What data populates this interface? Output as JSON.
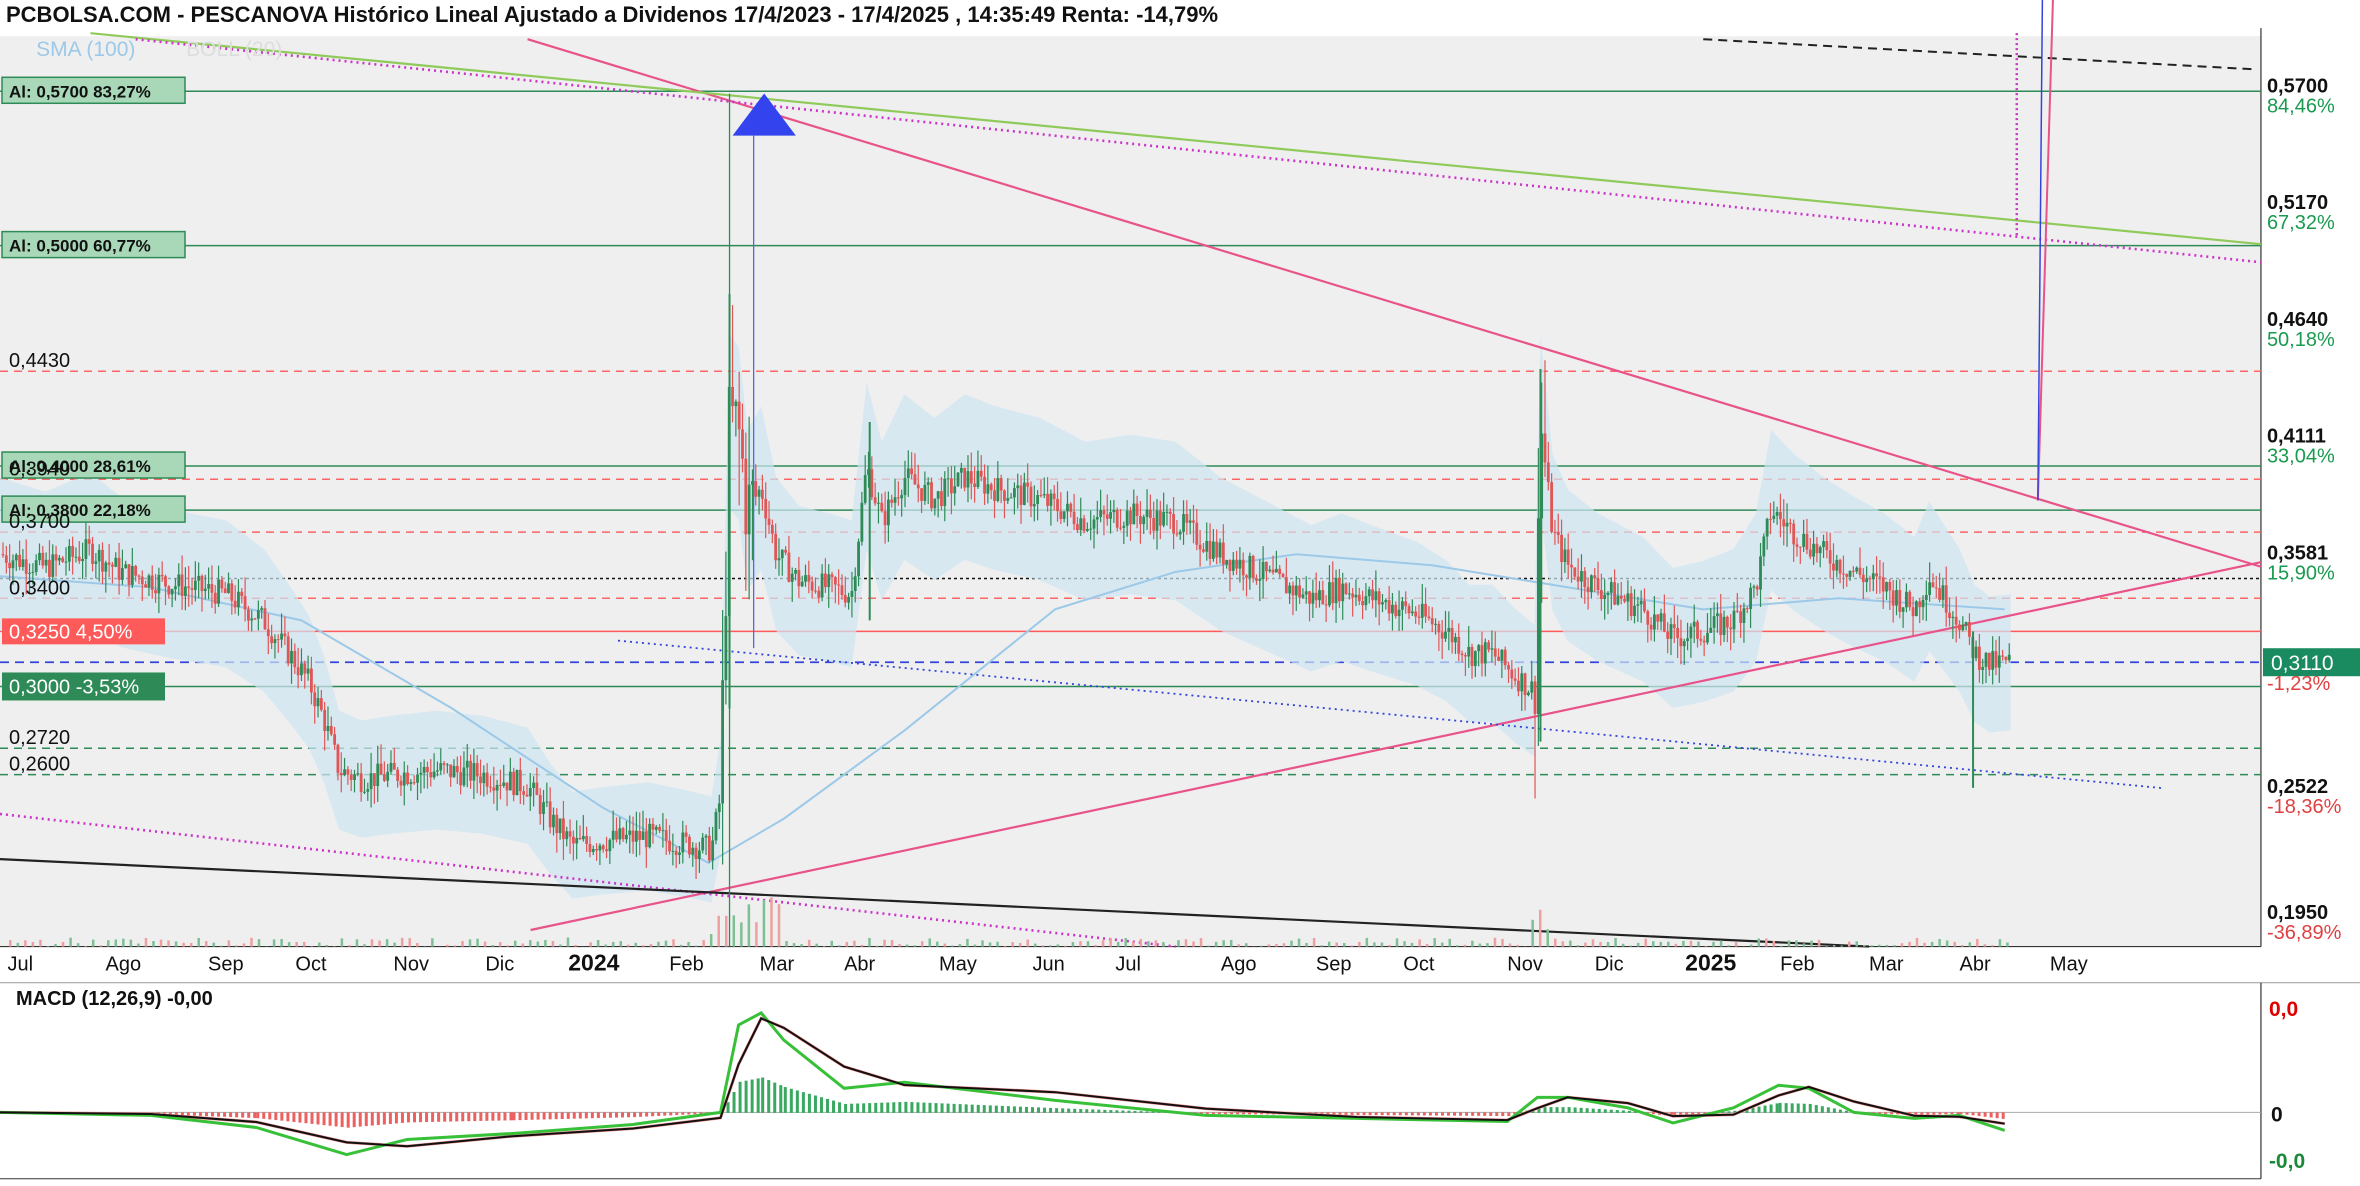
{
  "title": "PCBOLSA.COM - PESCANOVA Histórico Lineal Ajustado a Dividenos 17/4/2023 - 17/4/2025 , 14:35:49 Renta: -14,79%",
  "colors": {
    "up": "#2e8b57",
    "down": "#e05555",
    "pink": "#e8538a",
    "magenta": "#cc33cc",
    "blue": "#3344dd",
    "green": "#2e8b57",
    "lightgreen": "#8fca5a",
    "red": "#ff5a5a"
  },
  "chart_data": [
    {
      "type": "line",
      "name": "main",
      "legend": [
        "SMA (100)",
        "BOLL (20)"
      ],
      "ylim": [
        0.182,
        0.595
      ],
      "price_axis": [
        {
          "v": 0.57,
          "label": "0,5700",
          "pct": "84,46%",
          "pcolor": "#1a9a50"
        },
        {
          "v": 0.517,
          "label": "0,5170",
          "pct": "67,32%",
          "pcolor": "#1a9a50"
        },
        {
          "v": 0.464,
          "label": "0,4640",
          "pct": "50,18%",
          "pcolor": "#1a9a50"
        },
        {
          "v": 0.4111,
          "label": "0,4111",
          "pct": "33,04%",
          "pcolor": "#1a9a50"
        },
        {
          "v": 0.3581,
          "label": "0,3581",
          "pct": "15,90%",
          "pcolor": "#1a9a50"
        },
        {
          "v": 0.2522,
          "label": "0,2522",
          "pct": "-18,36%",
          "pcolor": "#e04040"
        },
        {
          "v": 0.195,
          "label": "0,1950",
          "pct": "-36,89%",
          "pcolor": "#e04040"
        }
      ],
      "current": {
        "v": 0.311,
        "label": "0,3110",
        "pct": "-1,23%"
      },
      "months": [
        {
          "label": "Jul",
          "x": 5,
          "bold": false
        },
        {
          "label": "Ago",
          "x": 70,
          "bold": false
        },
        {
          "label": "Sep",
          "x": 138,
          "bold": false
        },
        {
          "label": "Oct",
          "x": 196,
          "bold": false
        },
        {
          "label": "Nov",
          "x": 261,
          "bold": false
        },
        {
          "label": "Dic",
          "x": 322,
          "bold": false
        },
        {
          "label": "2024",
          "x": 377,
          "bold": true
        },
        {
          "label": "Feb",
          "x": 444,
          "bold": false
        },
        {
          "label": "Mar",
          "x": 504,
          "bold": false
        },
        {
          "label": "Abr",
          "x": 560,
          "bold": false
        },
        {
          "label": "May",
          "x": 623,
          "bold": false
        },
        {
          "label": "Jun",
          "x": 685,
          "bold": false
        },
        {
          "label": "Jul",
          "x": 740,
          "bold": false
        },
        {
          "label": "Ago",
          "x": 810,
          "bold": false
        },
        {
          "label": "Sep",
          "x": 873,
          "bold": false
        },
        {
          "label": "Oct",
          "x": 931,
          "bold": false
        },
        {
          "label": "Nov",
          "x": 1000,
          "bold": false
        },
        {
          "label": "Dic",
          "x": 1058,
          "bold": false
        },
        {
          "label": "2025",
          "x": 1118,
          "bold": true
        },
        {
          "label": "Feb",
          "x": 1181,
          "bold": false
        },
        {
          "label": "Mar",
          "x": 1240,
          "bold": false
        },
        {
          "label": "Abr",
          "x": 1300,
          "bold": false
        },
        {
          "label": "May",
          "x": 1360,
          "bold": false
        }
      ],
      "levels": [
        {
          "v": 0.57,
          "label": "Al: 0,5700",
          "pct": "83,27%",
          "kind": "al"
        },
        {
          "v": 0.5,
          "label": "Al: 0,5000",
          "pct": "60,77%",
          "kind": "al"
        },
        {
          "v": 0.4,
          "label": "Al: 0,4000",
          "pct": "28,61%",
          "kind": "al"
        },
        {
          "v": 0.38,
          "label": "Al: 0,3800",
          "pct": "22,18%",
          "kind": "al"
        },
        {
          "v": 0.3,
          "label": "0,3000",
          "pct": "-3,53%",
          "kind": "green"
        },
        {
          "v": 0.325,
          "label": "0,3250",
          "pct": "4,50%",
          "kind": "red"
        },
        {
          "v": 0.443,
          "label": "0,4430",
          "kind": "plain"
        },
        {
          "v": 0.394,
          "label": "0,3940",
          "kind": "plain"
        },
        {
          "v": 0.37,
          "label": "0,3700",
          "kind": "plain"
        },
        {
          "v": 0.34,
          "label": "0,3400",
          "kind": "plain"
        },
        {
          "v": 0.272,
          "label": "0,2720",
          "kind": "plain"
        },
        {
          "v": 0.26,
          "label": "0,2600",
          "kind": "plain"
        }
      ],
      "price_series": [
        [
          0,
          0.36
        ],
        [
          30,
          0.354
        ],
        [
          60,
          0.362
        ],
        [
          80,
          0.352
        ],
        [
          110,
          0.347
        ],
        [
          150,
          0.342
        ],
        [
          175,
          0.33
        ],
        [
          195,
          0.312
        ],
        [
          205,
          0.302
        ],
        [
          215,
          0.285
        ],
        [
          225,
          0.262
        ],
        [
          240,
          0.258
        ],
        [
          260,
          0.26
        ],
        [
          290,
          0.262
        ],
        [
          320,
          0.26
        ],
        [
          350,
          0.255
        ],
        [
          365,
          0.24
        ],
        [
          380,
          0.228
        ],
        [
          400,
          0.23
        ],
        [
          430,
          0.232
        ],
        [
          460,
          0.228
        ],
        [
          472,
          0.226
        ],
        [
          478,
          0.25
        ],
        [
          484,
          0.42
        ],
        [
          490,
          0.415
        ],
        [
          496,
          0.38
        ],
        [
          505,
          0.39
        ],
        [
          515,
          0.36
        ],
        [
          530,
          0.348
        ],
        [
          550,
          0.345
        ],
        [
          565,
          0.342
        ],
        [
          575,
          0.4
        ],
        [
          585,
          0.375
        ],
        [
          600,
          0.395
        ],
        [
          620,
          0.385
        ],
        [
          640,
          0.395
        ],
        [
          660,
          0.39
        ],
        [
          690,
          0.385
        ],
        [
          720,
          0.375
        ],
        [
          750,
          0.378
        ],
        [
          780,
          0.375
        ],
        [
          810,
          0.36
        ],
        [
          840,
          0.35
        ],
        [
          870,
          0.34
        ],
        [
          890,
          0.345
        ],
        [
          910,
          0.34
        ],
        [
          940,
          0.333
        ],
        [
          960,
          0.325
        ],
        [
          975,
          0.315
        ],
        [
          990,
          0.315
        ],
        [
          1005,
          0.305
        ],
        [
          1018,
          0.298
        ],
        [
          1022,
          0.42
        ],
        [
          1030,
          0.37
        ],
        [
          1040,
          0.355
        ],
        [
          1060,
          0.345
        ],
        [
          1090,
          0.335
        ],
        [
          1110,
          0.322
        ],
        [
          1130,
          0.325
        ],
        [
          1150,
          0.33
        ],
        [
          1165,
          0.345
        ],
        [
          1175,
          0.38
        ],
        [
          1190,
          0.37
        ],
        [
          1210,
          0.36
        ],
        [
          1230,
          0.352
        ],
        [
          1250,
          0.345
        ],
        [
          1270,
          0.335
        ],
        [
          1280,
          0.35
        ],
        [
          1290,
          0.34
        ],
        [
          1300,
          0.33
        ],
        [
          1310,
          0.315
        ],
        [
          1320,
          0.31
        ],
        [
          1334,
          0.311
        ]
      ]
    },
    {
      "type": "line",
      "name": "macd",
      "label": "MACD (12,26,9)",
      "value": "-0,00",
      "axis": [
        {
          "label": "0,0",
          "color": "#e00000"
        },
        {
          "label": "0",
          "color": "#111111"
        },
        {
          "label": "-0,0",
          "color": "#1a8a3a"
        }
      ]
    }
  ]
}
